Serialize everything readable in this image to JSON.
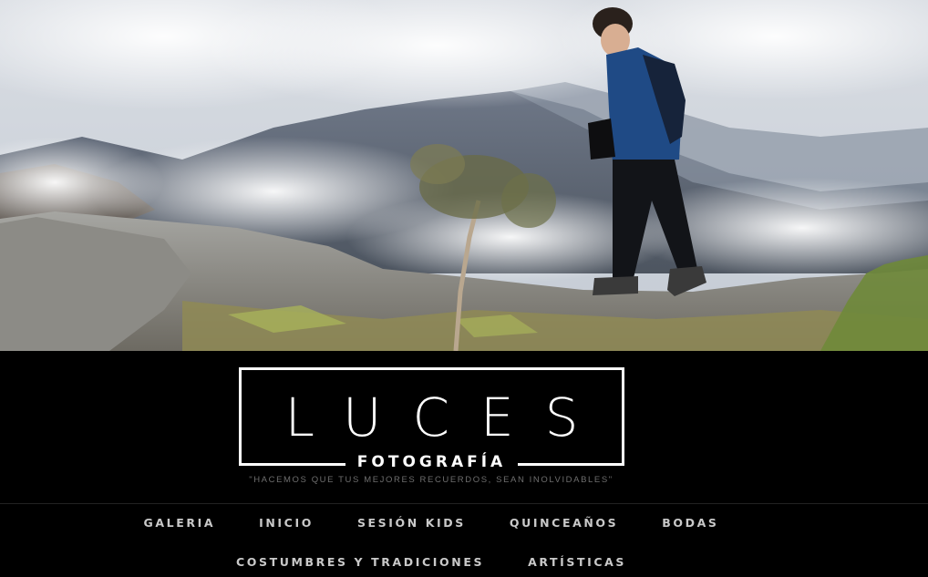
{
  "hero": {
    "image": "mountain-hiker-photo",
    "colors": {
      "sky": "#dfe3e8",
      "mountains": "#5b6574",
      "rock": "#9a9a94",
      "moss": "#9a9455",
      "jacket": "#1f4a85",
      "pants": "#121418"
    }
  },
  "logo": {
    "word": "LUCES",
    "subtitle": "FOTOGRAFÍA"
  },
  "tagline": "\"HACEMOS QUE TUS MEJORES RECUERDOS, SEAN INOLVIDABLES\"",
  "nav": {
    "row1": [
      "GALERIA",
      "INICIO",
      "SESIÓN KIDS",
      "QUINCEAÑOS",
      "BODAS"
    ],
    "row2": [
      "COSTUMBRES Y TRADICIONES",
      "ARTÍSTICAS"
    ]
  }
}
